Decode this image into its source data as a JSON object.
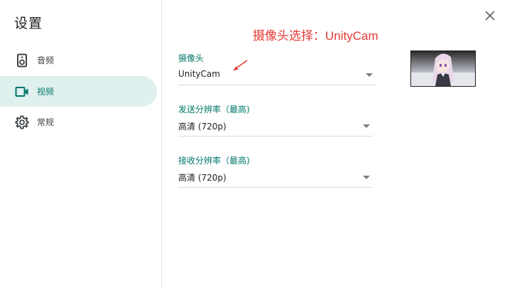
{
  "dialog": {
    "title": "设置",
    "close_icon": "close-icon"
  },
  "sidebar": {
    "items": [
      {
        "label": "音频",
        "icon": "speaker-icon",
        "active": false
      },
      {
        "label": "视频",
        "icon": "video-camera-icon",
        "active": true
      },
      {
        "label": "常规",
        "icon": "gear-icon",
        "active": false
      }
    ]
  },
  "annotation": {
    "text": "摄像头选择：UnityCam",
    "color": "#e53935"
  },
  "camera": {
    "label": "摄像头",
    "value": "UnityCam"
  },
  "send_resolution": {
    "label": "发送分辨率（最高)",
    "value": "高清 (720p)"
  },
  "receive_resolution": {
    "label": "接收分辨率（最高)",
    "value": "高清 (720p)"
  },
  "colors": {
    "accent": "#00796b",
    "active_bg": "#e0f0ee"
  }
}
